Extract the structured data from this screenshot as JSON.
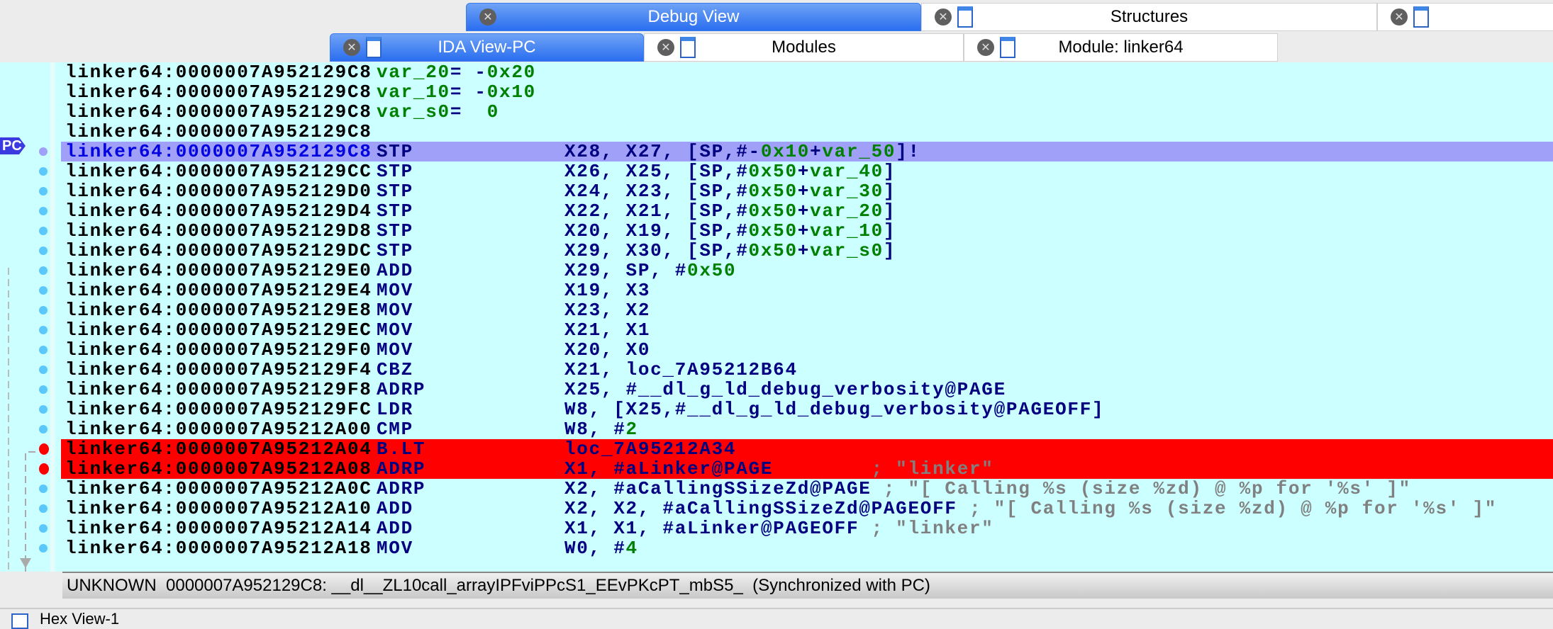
{
  "tabs_top": [
    {
      "label": "Debug View",
      "active": true
    },
    {
      "label": "Structures",
      "active": false
    },
    {
      "label": "",
      "active": false
    }
  ],
  "tabs_bottom": [
    {
      "label": "IDA View-PC",
      "active": true
    },
    {
      "label": "Modules",
      "active": false
    },
    {
      "label": "Module: linker64",
      "active": false
    }
  ],
  "pc_label": "PC",
  "colors": {
    "background": "#ccffff",
    "pc_highlight": "#a0a0f8",
    "breakpoint": "#ff0000",
    "mnemonic": "#000080",
    "number": "#008000",
    "comment": "#808080"
  },
  "lines": [
    {
      "addr": "linker64:0000007A952129C8",
      "decl": [
        {
          "t": "var_20",
          "c": "g"
        },
        {
          "t": "= -",
          "c": "n"
        },
        {
          "t": "0x20",
          "c": "g"
        }
      ]
    },
    {
      "addr": "linker64:0000007A952129C8",
      "decl": [
        {
          "t": "var_10",
          "c": "g"
        },
        {
          "t": "= -",
          "c": "n"
        },
        {
          "t": "0x10",
          "c": "g"
        }
      ]
    },
    {
      "addr": "linker64:0000007A952129C8",
      "decl": [
        {
          "t": "var_s0",
          "c": "g"
        },
        {
          "t": "=  ",
          "c": "n"
        },
        {
          "t": "0",
          "c": "g"
        }
      ]
    },
    {
      "addr": "linker64:0000007A952129C8"
    },
    {
      "addr": "linker64:0000007A952129C8",
      "mnem": "STP",
      "state": "pc",
      "ops": [
        {
          "t": "X28, X27, [SP,#-",
          "c": "n"
        },
        {
          "t": "0x10",
          "c": "g"
        },
        {
          "t": "+",
          "c": "n"
        },
        {
          "t": "var_50",
          "c": "g"
        },
        {
          "t": "]!",
          "c": "n"
        }
      ]
    },
    {
      "addr": "linker64:0000007A952129CC",
      "mnem": "STP",
      "ops": [
        {
          "t": "X26, X25, [SP,#",
          "c": "n"
        },
        {
          "t": "0x50",
          "c": "g"
        },
        {
          "t": "+",
          "c": "n"
        },
        {
          "t": "var_40",
          "c": "g"
        },
        {
          "t": "]",
          "c": "n"
        }
      ]
    },
    {
      "addr": "linker64:0000007A952129D0",
      "mnem": "STP",
      "ops": [
        {
          "t": "X24, X23, [SP,#",
          "c": "n"
        },
        {
          "t": "0x50",
          "c": "g"
        },
        {
          "t": "+",
          "c": "n"
        },
        {
          "t": "var_30",
          "c": "g"
        },
        {
          "t": "]",
          "c": "n"
        }
      ]
    },
    {
      "addr": "linker64:0000007A952129D4",
      "mnem": "STP",
      "ops": [
        {
          "t": "X22, X21, [SP,#",
          "c": "n"
        },
        {
          "t": "0x50",
          "c": "g"
        },
        {
          "t": "+",
          "c": "n"
        },
        {
          "t": "var_20",
          "c": "g"
        },
        {
          "t": "]",
          "c": "n"
        }
      ]
    },
    {
      "addr": "linker64:0000007A952129D8",
      "mnem": "STP",
      "ops": [
        {
          "t": "X20, X19, [SP,#",
          "c": "n"
        },
        {
          "t": "0x50",
          "c": "g"
        },
        {
          "t": "+",
          "c": "n"
        },
        {
          "t": "var_10",
          "c": "g"
        },
        {
          "t": "]",
          "c": "n"
        }
      ]
    },
    {
      "addr": "linker64:0000007A952129DC",
      "mnem": "STP",
      "ops": [
        {
          "t": "X29, X30, [SP,#",
          "c": "n"
        },
        {
          "t": "0x50",
          "c": "g"
        },
        {
          "t": "+",
          "c": "n"
        },
        {
          "t": "var_s0",
          "c": "g"
        },
        {
          "t": "]",
          "c": "n"
        }
      ]
    },
    {
      "addr": "linker64:0000007A952129E0",
      "mnem": "ADD",
      "ops": [
        {
          "t": "X29, SP, #",
          "c": "n"
        },
        {
          "t": "0x50",
          "c": "g"
        }
      ]
    },
    {
      "addr": "linker64:0000007A952129E4",
      "mnem": "MOV",
      "ops": [
        {
          "t": "X19, X3",
          "c": "n"
        }
      ]
    },
    {
      "addr": "linker64:0000007A952129E8",
      "mnem": "MOV",
      "ops": [
        {
          "t": "X23, X2",
          "c": "n"
        }
      ]
    },
    {
      "addr": "linker64:0000007A952129EC",
      "mnem": "MOV",
      "ops": [
        {
          "t": "X21, X1",
          "c": "n"
        }
      ]
    },
    {
      "addr": "linker64:0000007A952129F0",
      "mnem": "MOV",
      "ops": [
        {
          "t": "X20, X0",
          "c": "n"
        }
      ]
    },
    {
      "addr": "linker64:0000007A952129F4",
      "mnem": "CBZ",
      "ops": [
        {
          "t": "X21, loc_7A95212B64",
          "c": "n"
        }
      ]
    },
    {
      "addr": "linker64:0000007A952129F8",
      "mnem": "ADRP",
      "ops": [
        {
          "t": "X25, #__dl_g_ld_debug_verbosity@PAGE",
          "c": "n"
        }
      ]
    },
    {
      "addr": "linker64:0000007A952129FC",
      "mnem": "LDR",
      "ops": [
        {
          "t": "W8, [X25,#__dl_g_ld_debug_verbosity@PAGEOFF]",
          "c": "n"
        }
      ]
    },
    {
      "addr": "linker64:0000007A95212A00",
      "mnem": "CMP",
      "ops": [
        {
          "t": "W8, #",
          "c": "n"
        },
        {
          "t": "2",
          "c": "g"
        }
      ]
    },
    {
      "addr": "linker64:0000007A95212A04",
      "mnem": "B.LT",
      "state": "bp",
      "ops": [
        {
          "t": "loc_7A95212A34",
          "c": "n"
        }
      ]
    },
    {
      "addr": "linker64:0000007A95212A08",
      "mnem": "ADRP",
      "state": "bp",
      "ops": [
        {
          "t": "X1, #aLinker@PAGE",
          "c": "n"
        },
        {
          "t": "        ; \"linker\"",
          "c": "c"
        }
      ]
    },
    {
      "addr": "linker64:0000007A95212A0C",
      "mnem": "ADRP",
      "ops": [
        {
          "t": "X2, #aCallingSSizeZd@PAGE",
          "c": "n"
        },
        {
          "t": " ; \"[ Calling %s (size %zd) @ %p for '%s' ]\"",
          "c": "c"
        }
      ]
    },
    {
      "addr": "linker64:0000007A95212A10",
      "mnem": "ADD",
      "ops": [
        {
          "t": "X2, X2, #aCallingSSizeZd@PAGEOFF",
          "c": "n"
        },
        {
          "t": " ; \"[ Calling %s (size %zd) @ %p for '%s' ]\"",
          "c": "c"
        }
      ]
    },
    {
      "addr": "linker64:0000007A95212A14",
      "mnem": "ADD",
      "ops": [
        {
          "t": "X1, X1, #aLinker@PAGEOFF",
          "c": "n"
        },
        {
          "t": " ; \"linker\"",
          "c": "c"
        }
      ]
    },
    {
      "addr": "linker64:0000007A95212A18",
      "mnem": "MOV",
      "ops": [
        {
          "t": "W0, #",
          "c": "n"
        },
        {
          "t": "4",
          "c": "g"
        }
      ]
    }
  ],
  "status": "UNKNOWN  0000007A952129C8: __dl__ZL10call_arrayIPFviPPcS1_EEvPKcPT_mbS5_  (Synchronized with PC)",
  "hex_view_tab": "Hex View-1"
}
